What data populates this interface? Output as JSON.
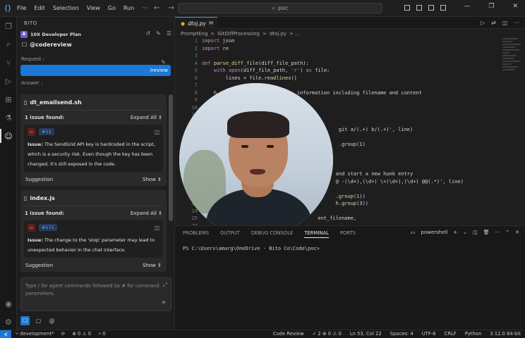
{
  "titlebar": {
    "menu": [
      "File",
      "Edit",
      "Selection",
      "View",
      "Go",
      "Run",
      "···"
    ],
    "search": "poc",
    "controls": [
      "—",
      "❐",
      "✕"
    ]
  },
  "sidebar": {
    "header": "BITO",
    "plan": "10X Developer Plan",
    "mode": "@codereview",
    "request_label": "Request :",
    "request_text": "/review",
    "answer_label": "Answer :",
    "cards": [
      {
        "file": "dt_emailsend.sh",
        "issues_found": "1 issue found:",
        "expand": "Expand All",
        "issue_number": "#11",
        "issue_label": "Issue:",
        "issue_text": "The SendGrid API key is hardcoded in the script, which is a security risk. Even though the key has been changed, it's still exposed in the code.",
        "suggestion": "Suggestion",
        "show": "Show"
      },
      {
        "file": "index.js",
        "issues_found": "1 issue found:",
        "expand": "Expand All",
        "issue_number": "#171",
        "issue_label": "Issue:",
        "issue_text": "The change to the 'stop' parameter may lead to unexpected behavior in the chat interface.",
        "suggestion": "Suggestion",
        "show": "Show"
      }
    ],
    "chat_placeholder": "Type / for agent commands followed by # for command parameters."
  },
  "editor": {
    "tab_name": "dtoj.py",
    "tab_modified": "M",
    "breadcrumb": [
      "PromptEng",
      ">",
      "GitDiffProcessing",
      ">",
      "dtoj.py",
      "> ..."
    ],
    "lines": [
      {
        "n": "1",
        "t": "import json"
      },
      {
        "n": "2",
        "t": "import re"
      },
      {
        "n": "3",
        "t": ""
      },
      {
        "n": "4",
        "t": "def parse_diff_file(diff_file_path):"
      },
      {
        "n": "5",
        "t": "    with open(diff_file_path, 'r') as file:"
      },
      {
        "n": "6",
        "t": "        lines = file.readlines()"
      },
      {
        "n": "7",
        "t": ""
      },
      {
        "n": "8",
        "t": "    h                           information including filename and content"
      },
      {
        "n": "9",
        "t": ""
      },
      {
        "n": "10",
        "t": ""
      },
      {
        "n": "11",
        "t": ""
      },
      {
        "n": "12",
        "t": ""
      },
      {
        "n": "13",
        "t": "                                              git a/(.+) b/(.+)', line)"
      },
      {
        "n": "14",
        "t": ""
      },
      {
        "n": "15",
        "t": "                                              .group(1)"
      },
      {
        "n": "16",
        "t": ""
      },
      {
        "n": "17",
        "t": ""
      },
      {
        "n": "18",
        "t": ""
      },
      {
        "n": "19",
        "t": "                                             and start a new hunk entry"
      },
      {
        "n": "20",
        "t": "                                             @ -(\\d+),(\\d+) \\+(\\d+),(\\d+) @@(.*)', line)"
      },
      {
        "n": "21",
        "t": ""
      },
      {
        "n": "22",
        "t": "                                             .group(1))"
      },
      {
        "n": "23",
        "t": "                                             h.group(3))"
      },
      {
        "n": "24",
        "t": ""
      },
      {
        "n": "25",
        "t": "                                       ent_filename,"
      },
      {
        "n": "26",
        "t": ""
      }
    ]
  },
  "panel": {
    "tabs": [
      "PROBLEMS",
      "OUTPUT",
      "DEBUG CONSOLE",
      "TERMINAL",
      "PORTS"
    ],
    "active_tab": "TERMINAL",
    "shell": "powershell",
    "prompt": "PS C:\\Users\\amarg\\OneDrive - Bito Co\\Code\\poc> "
  },
  "status": {
    "remote": "⊀",
    "branch": "development*",
    "sync": "⟳",
    "errors": "⊗ 0 ⚠ 0",
    "ports": "⑃ 0",
    "code_review": "Code Review",
    "checks": "✓ 2 ⊗ 0 ⚠ 0",
    "position": "Ln 53, Col 22",
    "spaces": "Spaces: 4",
    "encoding": "UTF-8",
    "eol": "CRLF",
    "language": "Python",
    "interpreter": "3.12.0 64-bit"
  }
}
